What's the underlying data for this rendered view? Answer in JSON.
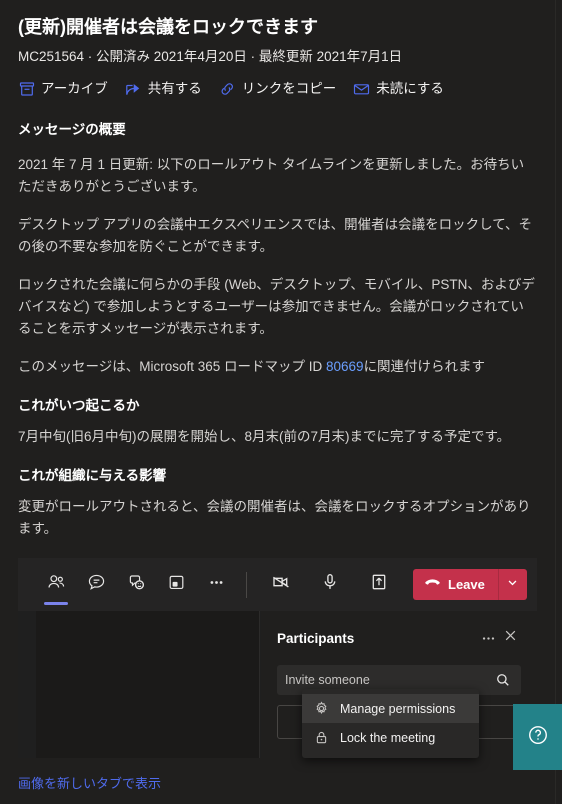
{
  "message": {
    "title": "(更新)開催者は会議をロックできます",
    "meta": "MC251564 · 公開済み 2021年4月20日 · 最終更新 2021年7月1日",
    "actions": [
      {
        "icon": "archive-icon",
        "label": "アーカイブ"
      },
      {
        "icon": "share-icon",
        "label": "共有する"
      },
      {
        "icon": "link-icon",
        "label": "リンクをコピー"
      },
      {
        "icon": "mail-icon",
        "label": "未読にする"
      }
    ],
    "summary_heading": "メッセージの概要",
    "paragraphs": {
      "p1": "2021 年 7 月 1 日更新: 以下のロールアウト タイムラインを更新しました。お待ちいただきありがとうございます。",
      "p2": "デスクトップ アプリの会議中エクスペリエンスでは、開催者は会議をロックして、その後の不要な参加を防ぐことができます。",
      "p3": "ロックされた会議に何らかの手段 (Web、デスクトップ、モバイル、PSTN、およびデバイスなど) で参加しようとするユーザーは参加できません。会議がロックされていることを示すメッセージが表示されます。",
      "p4_pre": "このメッセージは、Microsoft 365 ロードマップ ID ",
      "p4_link": "80669",
      "p4_post": "に関連付けられます"
    },
    "when_heading": "これがいつ起こるか",
    "when_text": "7月中旬(旧6月中旬)の展開を開始し、8月末(前の7月末)までに完了する予定です。",
    "impact_heading": "これが組織に与える影響",
    "impact_text": "変更がロールアウトされると、会議の開催者は、会議をロックするオプションがあります。",
    "image_link": "画像を新しいタブで表示"
  },
  "screenshot": {
    "toolbar": {
      "items": [
        {
          "icon": "people-icon",
          "name": "show-participants",
          "active": true
        },
        {
          "icon": "chat-icon",
          "name": "show-conversation",
          "active": false
        },
        {
          "icon": "reactions-icon",
          "name": "reactions",
          "active": false
        },
        {
          "icon": "breakout-rooms-icon",
          "name": "breakout-rooms",
          "active": false
        },
        {
          "icon": "more-icon",
          "name": "more-actions",
          "active": false
        }
      ],
      "camera_icon": "camera-off-icon",
      "mic_icon": "microphone-icon",
      "share_icon": "share-screen-icon",
      "leave_label": "Leave",
      "leave_color": "#c4314b"
    },
    "panel": {
      "title": "Participants",
      "more_icon": "more-icon",
      "close_icon": "close-icon",
      "invite_placeholder": "Invite someone",
      "search_icon": "search-icon"
    },
    "context_menu": [
      {
        "icon": "gear-icon",
        "label": "Manage permissions",
        "hovered": true
      },
      {
        "icon": "lock-icon",
        "label": "Lock the meeting",
        "hovered": false
      }
    ],
    "help_fab": {
      "icon": "help-icon",
      "color": "#238289"
    }
  }
}
